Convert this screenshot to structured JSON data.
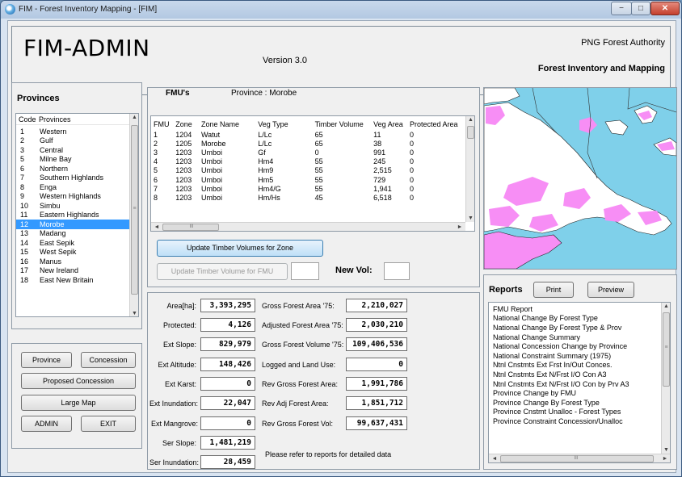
{
  "window": {
    "title": "FIM - Forest Inventory Mapping - [FIM]",
    "min": "−",
    "max": "□",
    "close": "✕"
  },
  "header": {
    "app_name": "FIM-ADMIN",
    "version": "Version 3.0",
    "org": "PNG Forest Authority",
    "subtitle": "Forest Inventory and Mapping"
  },
  "provinces": {
    "title": "Provinces",
    "col_code": "Code",
    "col_name": "Provinces",
    "items": [
      {
        "code": "1",
        "name": "Western"
      },
      {
        "code": "2",
        "name": "Gulf"
      },
      {
        "code": "3",
        "name": "Central"
      },
      {
        "code": "5",
        "name": "Milne Bay"
      },
      {
        "code": "6",
        "name": "Northern"
      },
      {
        "code": "7",
        "name": "Southern Highlands"
      },
      {
        "code": "8",
        "name": "Enga"
      },
      {
        "code": "9",
        "name": "Western Highlands"
      },
      {
        "code": "10",
        "name": "Simbu"
      },
      {
        "code": "11",
        "name": "Eastern Highlands"
      },
      {
        "code": "12",
        "name": "Morobe"
      },
      {
        "code": "13",
        "name": "Madang"
      },
      {
        "code": "14",
        "name": "East Sepik"
      },
      {
        "code": "15",
        "name": "West Sepik"
      },
      {
        "code": "16",
        "name": "Manus"
      },
      {
        "code": "17",
        "name": "New Ireland"
      },
      {
        "code": "18",
        "name": "East New Britain"
      }
    ],
    "selected_code": "12"
  },
  "nav_buttons": {
    "province": "Province",
    "concession": "Concession",
    "proposed": "Proposed Concession",
    "large_map": "Large Map",
    "admin": "ADMIN",
    "exit": "EXIT"
  },
  "fmu": {
    "title": "FMU's",
    "province_label": "Province : Morobe",
    "columns": [
      "FMU",
      "Zone",
      "Zone Name",
      "Veg Type",
      "Timber Volume",
      "Veg Area",
      "Protected Area"
    ],
    "rows": [
      [
        "1",
        "1204",
        "Watut",
        "L/Lc",
        "65",
        "11",
        "0"
      ],
      [
        "2",
        "1205",
        "Morobe",
        "L/Lc",
        "65",
        "38",
        "0"
      ],
      [
        "3",
        "1203",
        "Umboi",
        "Gf",
        "0",
        "991",
        "0"
      ],
      [
        "4",
        "1203",
        "Umboi",
        "Hm4",
        "55",
        "245",
        "0"
      ],
      [
        "5",
        "1203",
        "Umboi",
        "Hm9",
        "55",
        "2,515",
        "0"
      ],
      [
        "6",
        "1203",
        "Umboi",
        "Hm5",
        "55",
        "729",
        "0"
      ],
      [
        "7",
        "1203",
        "Umboi",
        "Hm4/G",
        "55",
        "1,941",
        "0"
      ],
      [
        "8",
        "1203",
        "Umboi",
        "Hm/Hs",
        "45",
        "6,518",
        "0"
      ]
    ],
    "update_zone_btn": "Update Timber Volumes for Zone",
    "update_fmu_btn": "Update Timber Volume for FMU",
    "new_vol_label": "New Vol:",
    "fmu_value": "",
    "new_vol_value": ""
  },
  "stats": {
    "area_label": "Area[ha]:",
    "area": "3,393,295",
    "protected_label": "Protected:",
    "protected": "4,126",
    "ext_slope_label": "Ext Slope:",
    "ext_slope": "829,979",
    "ext_alt_label": "Ext Altitude:",
    "ext_alt": "148,426",
    "ext_karst_label": "Ext Karst:",
    "ext_karst": "0",
    "ext_inund_label": "Ext Inundation:",
    "ext_inund": "22,047",
    "ext_mangrove_label": "Ext Mangrove:",
    "ext_mangrove": "0",
    "ser_slope_label": "Ser Slope:",
    "ser_slope": "1,481,219",
    "ser_inund_label": "Ser Inundation:",
    "ser_inund": "28,459",
    "gross75_label": "Gross Forest Area '75:",
    "gross75": "2,210,027",
    "adj75_label": "Adjusted Forest Area '75:",
    "adj75": "2,030,210",
    "vol75_label": "Gross Forest Volume '75:",
    "vol75": "109,406,536",
    "logged_label": "Logged and Land Use:",
    "logged": "0",
    "rev_gross_label": "Rev Gross Forest Area:",
    "rev_gross": "1,991,786",
    "rev_adj_label": "Rev Adj Forest Area:",
    "rev_adj": "1,851,712",
    "rev_vol_label": "Rev Gross Forest Vol:",
    "rev_vol": "99,637,431",
    "note": "Please refer to reports for detailed data"
  },
  "reports": {
    "title": "Reports",
    "print": "Print",
    "preview": "Preview",
    "items": [
      "FMU Report",
      "National Change By Forest Type",
      "National Change By Forest Type & Prov",
      "National Change Summary",
      "National Concession Change by Province",
      "National Constraint Summary (1975)",
      "Ntnl Cnstmts Ext Frst In/Out Conces.",
      "Ntnl Cnstmts Ext N/Frst I/O Con A3",
      "Ntnl Cnstmts Ext N/Frst I/O Con by Prv A3",
      "Province Change by FMU",
      "Province Change By Forest Type",
      "Province Cnstmt Unalloc - Forest Types",
      "Province Constraint  Concession/Unalloc"
    ]
  },
  "scroll": {
    "up": "▲",
    "down": "▼",
    "left": "◄",
    "right": "►",
    "grip": "≡",
    "hgrip": "III"
  }
}
